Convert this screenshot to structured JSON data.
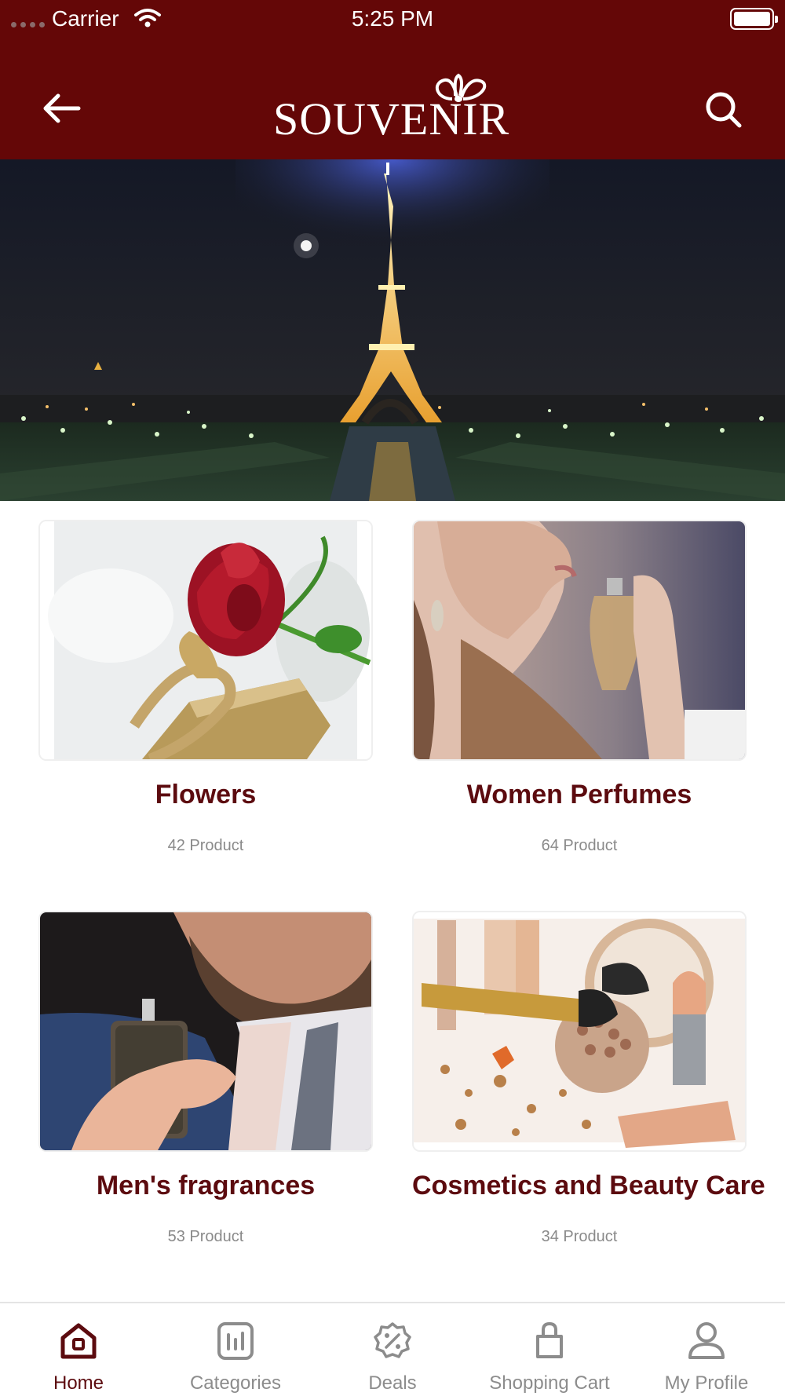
{
  "status_bar": {
    "carrier": "Carrier",
    "time": "5:25 PM"
  },
  "header": {
    "logo_text": "SOUVENIR",
    "back_icon": "arrow-left-icon",
    "search_icon": "search-icon",
    "brand_color": "#640707"
  },
  "hero": {
    "image": "eiffel-tower-night-photo"
  },
  "categories": [
    {
      "name": "Flowers",
      "count": "42 Product",
      "image": "red-rose-gift-photo"
    },
    {
      "name": "Women Perfumes",
      "count": "64 Product",
      "image": "woman-spraying-perfume-photo"
    },
    {
      "name": "Men's fragrances",
      "count": "53 Product",
      "image": "man-holding-cologne-photo"
    },
    {
      "name": "Cosmetics and Beauty Care",
      "count": "34 Product",
      "image": "makeup-products-photo"
    }
  ],
  "tab_bar": {
    "active_color": "#5c0b0f",
    "inactive_color": "#8c8c8c",
    "tabs": [
      {
        "label": "Home",
        "icon": "home-icon",
        "active": true
      },
      {
        "label": "Categories",
        "icon": "categories-icon",
        "active": false
      },
      {
        "label": "Deals",
        "icon": "percent-badge-icon",
        "active": false
      },
      {
        "label": "Shopping Cart",
        "icon": "shopping-bag-icon",
        "active": false
      },
      {
        "label": "My Profile",
        "icon": "user-icon",
        "active": false
      }
    ]
  }
}
